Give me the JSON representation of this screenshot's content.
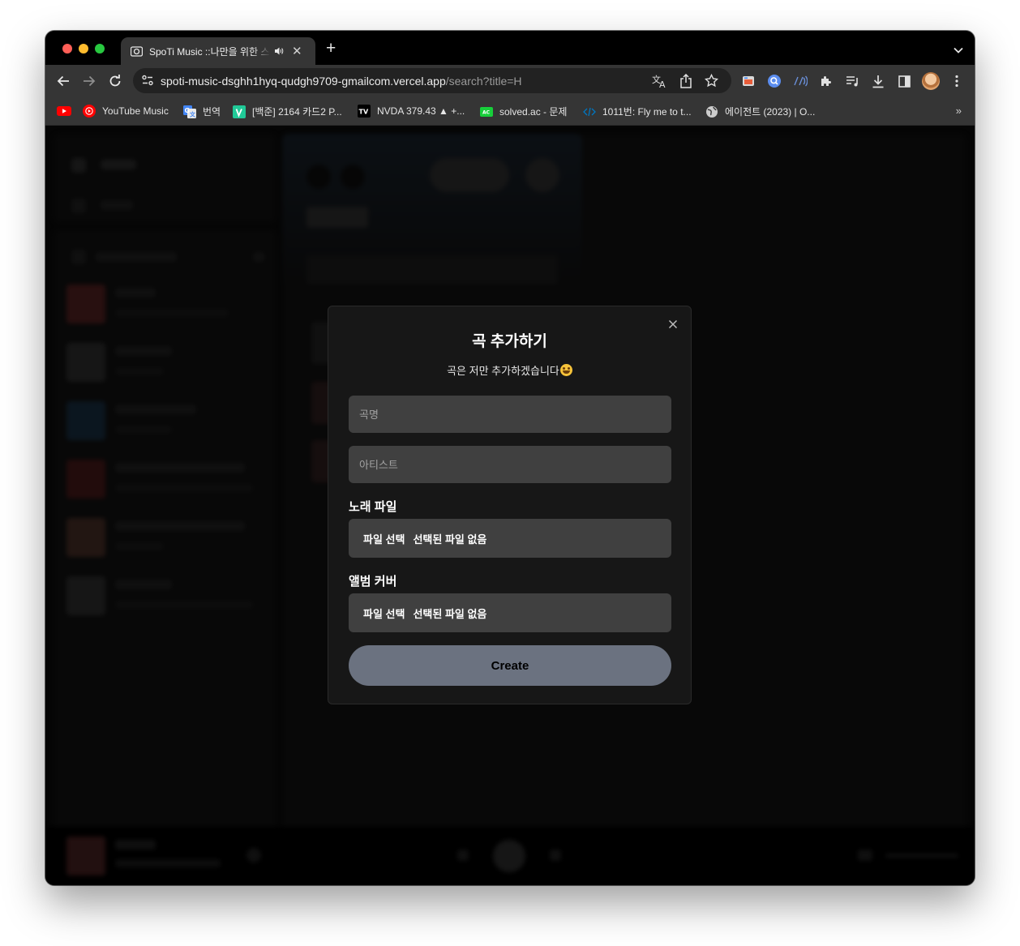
{
  "browser": {
    "tab": {
      "title": "SpoTi Music ::나만을 위한 스트리밍",
      "close_glyph": "✕"
    },
    "new_tab_glyph": "+",
    "url_host": "spoti-music-dsghh1hyq-qudgh9709-gmailcom.vercel.app",
    "url_path": "/search?title=H",
    "bookmarks": [
      {
        "label": "",
        "icon": "youtube-icon",
        "color": "#ff0000"
      },
      {
        "label": "YouTube Music",
        "icon": "youtube-music-icon",
        "color": "#ff0000"
      },
      {
        "label": "번역",
        "icon": "google-translate-icon",
        "color": "#4285f4"
      },
      {
        "label": "[백준] 2164 카드2 P...",
        "icon": "velog-icon",
        "color": "#20c997"
      },
      {
        "label": "NVDA 379.43 ▲ +...",
        "icon": "tradingview-icon",
        "color": "#000000"
      },
      {
        "label": "solved.ac - 문제",
        "icon": "solvedac-icon",
        "color": "#17ce3a"
      },
      {
        "label": "1011번: Fly me to t...",
        "icon": "code-icon",
        "color": "#0076c0"
      },
      {
        "label": "에이전트 (2023) | O...",
        "icon": "globe-icon",
        "color": "#cccccc"
      }
    ],
    "more_bookmarks_glyph": "»"
  },
  "modal": {
    "title": "곡 추가하기",
    "description": "곡은 저만 추가하겠습니다",
    "song_title_placeholder": "곡명",
    "artist_placeholder": "아티스트",
    "song_file_label": "노래 파일",
    "cover_label": "앨범 커버",
    "file_button": "파일 선택",
    "no_file_selected": "선택된 파일 없음",
    "create_button": "Create"
  },
  "colors": {
    "modal_bg": "#171717",
    "input_bg": "#404040",
    "create_button_bg": "#6b7280",
    "page_bg": "#121212"
  }
}
